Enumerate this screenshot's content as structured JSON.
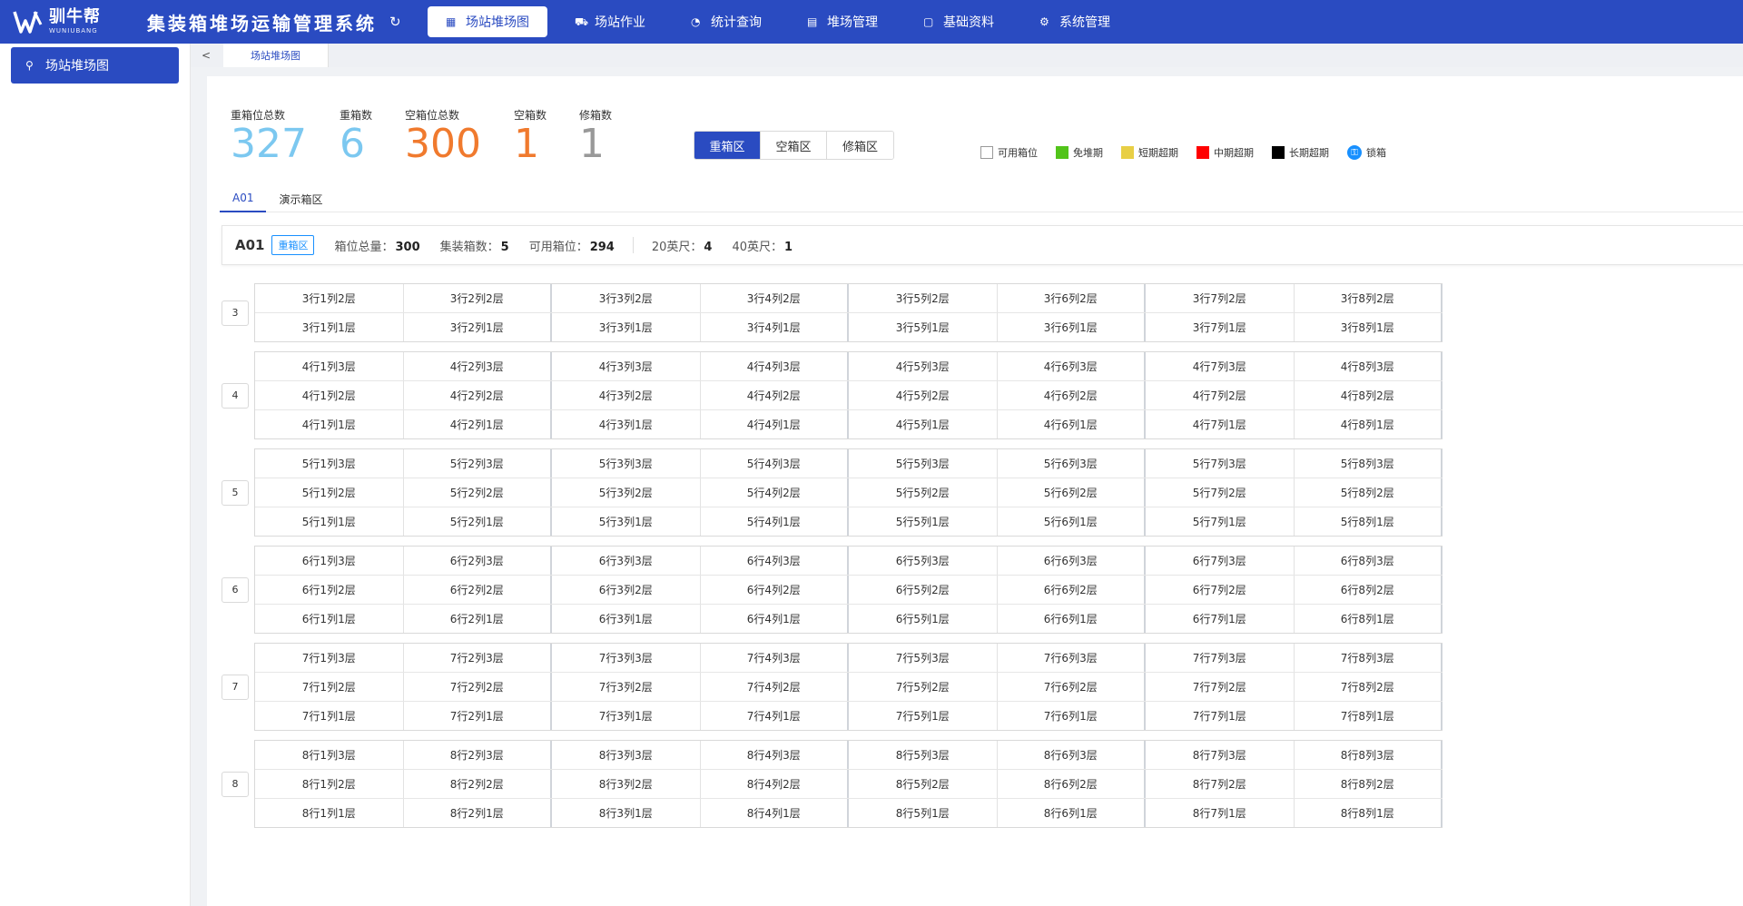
{
  "app": {
    "logo_name": "驯牛帮",
    "logo_sub": "WUNIUBANG",
    "title": "集装箱堆场运输管理系统"
  },
  "nav": [
    {
      "label": "场站堆场图",
      "icon": "grid-icon",
      "active": true
    },
    {
      "label": "场站作业",
      "icon": "forklift-icon",
      "active": false
    },
    {
      "label": "统计查询",
      "icon": "pie-chart-icon",
      "active": false
    },
    {
      "label": "堆场管理",
      "icon": "table-icon",
      "active": false
    },
    {
      "label": "基础资料",
      "icon": "document-icon",
      "active": false
    },
    {
      "label": "系统管理",
      "icon": "gear-icon",
      "active": false
    }
  ],
  "sidebar": {
    "items": [
      {
        "label": "场站堆场图",
        "icon": "sitemap-icon"
      }
    ]
  },
  "tabbar": {
    "back": "<",
    "tab_label": "场站堆场图"
  },
  "stats": [
    {
      "label": "重箱位总数",
      "value": "327",
      "color": "#7cc8f0"
    },
    {
      "label": "重箱数",
      "value": "6",
      "color": "#7cc8f0"
    },
    {
      "label": "空箱位总数",
      "value": "300",
      "color": "#f07a2e"
    },
    {
      "label": "空箱数",
      "value": "1",
      "color": "#f07a2e"
    },
    {
      "label": "修箱数",
      "value": "1",
      "color": "#999999"
    }
  ],
  "zone_switch": [
    {
      "label": "重箱区",
      "active": true
    },
    {
      "label": "空箱区",
      "active": false
    },
    {
      "label": "修箱区",
      "active": false
    }
  ],
  "legend": [
    {
      "label": "可用箱位",
      "color": "#ffffff",
      "border": "#999999"
    },
    {
      "label": "免堆期",
      "color": "#52c41a"
    },
    {
      "label": "短期超期",
      "color": "#e8cf45"
    },
    {
      "label": "中期超期",
      "color": "#ff0000"
    },
    {
      "label": "长期超期",
      "color": "#000000"
    },
    {
      "label": "锁箱",
      "icon": "lock-icon",
      "color": "#1890ff"
    }
  ],
  "subtabs": [
    {
      "label": "A01",
      "active": true
    },
    {
      "label": "演示箱区",
      "active": false
    }
  ],
  "info": {
    "area": "A01",
    "badge": "重箱区",
    "total_label": "箱位总量：",
    "total": "300",
    "count_label": "集装箱数：",
    "count": "5",
    "avail_label": "可用箱位：",
    "avail": "294",
    "ft20_label": "20英尺：",
    "ft20": "4",
    "ft40_label": "40英尺：",
    "ft40": "1"
  },
  "grid": {
    "columns": 8,
    "groups": [
      {
        "row": "3",
        "layers": [
          2,
          1
        ]
      },
      {
        "row": "4",
        "layers": [
          3,
          2,
          1
        ]
      },
      {
        "row": "5",
        "layers": [
          3,
          2,
          1
        ]
      },
      {
        "row": "6",
        "layers": [
          3,
          2,
          1
        ]
      },
      {
        "row": "7",
        "layers": [
          3,
          2,
          1
        ]
      },
      {
        "row": "8",
        "layers": [
          3,
          2,
          1
        ]
      }
    ]
  }
}
